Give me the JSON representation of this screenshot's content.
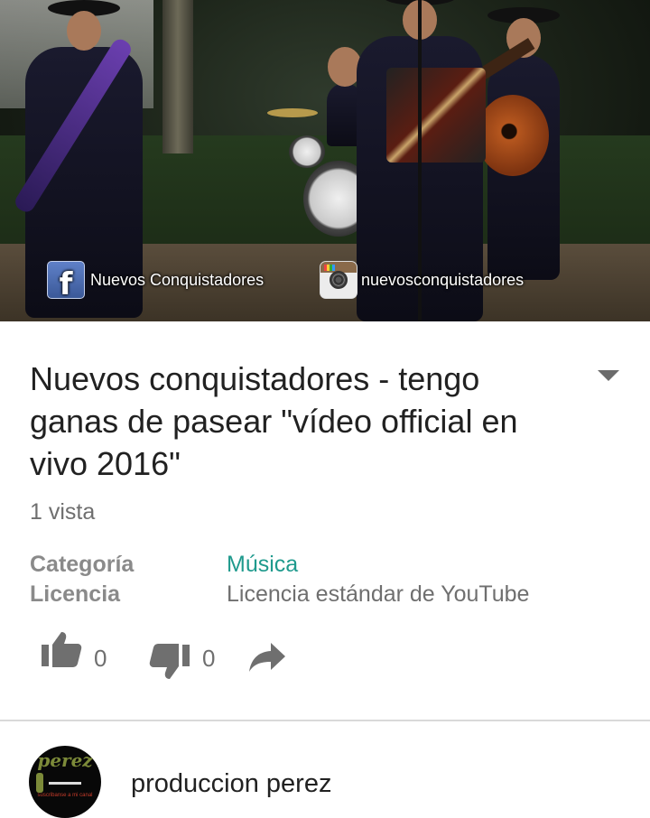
{
  "video": {
    "facebook_label": "Nuevos Conquistadores",
    "instagram_label": "nuevosconquistadores"
  },
  "title": "Nuevos conquistadores - tengo ganas de pasear \"vídeo official en vivo 2016\"",
  "views": "1 vista",
  "meta": {
    "category_label": "Categoría",
    "category_value": "Música",
    "license_label": "Licencia",
    "license_value": "Licencia estándar de YouTube"
  },
  "actions": {
    "likes": "0",
    "dislikes": "0"
  },
  "channel": {
    "name": "produccion perez",
    "avatar_text": "perez",
    "avatar_subtext": "suscribanse a mi canal"
  },
  "colors": {
    "accent": "#1f9a8d",
    "text_primary": "#212121",
    "text_secondary": "#6f6f6f"
  },
  "icons": [
    "facebook-icon",
    "instagram-icon",
    "expand-chevron-icon",
    "thumbs-up-icon",
    "thumbs-down-icon",
    "share-icon"
  ]
}
